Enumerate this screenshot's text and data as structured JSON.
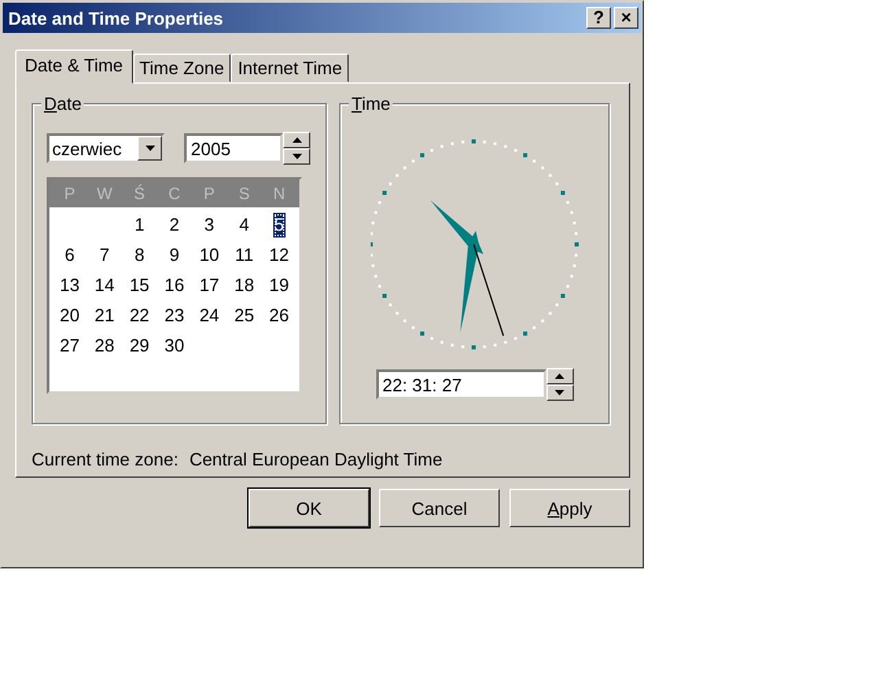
{
  "window": {
    "title": "Date and Time Properties",
    "title_buttons": [
      "?",
      "×"
    ]
  },
  "tabs": [
    {
      "label": "Date & Time",
      "selected": true
    },
    {
      "label": "Time Zone",
      "selected": false
    },
    {
      "label": "Internet Time",
      "selected": false
    }
  ],
  "date_group": {
    "label": "Date",
    "underlined_key": true,
    "month": "czerwiec",
    "year": "2005",
    "weekdays": [
      "P",
      "W",
      "Ś",
      "C",
      "P",
      "S",
      "N"
    ],
    "weeks": [
      [
        {
          "day": "1",
          "selected": false
        },
        {
          "day": "2",
          "selected": false
        },
        {
          "day": "3",
          "selected": false
        },
        {
          "day": "4",
          "selected": false
        },
        {
          "day": "5",
          "selected": true
        }
      ],
      [
        {
          "day": "6",
          "selected": false
        },
        {
          "day": "7",
          "selected": false
        },
        {
          "day": "8",
          "selected": false
        },
        {
          "day": "9",
          "selected": false
        },
        {
          "day": "10",
          "selected": false
        },
        {
          "day": "11",
          "selected": false
        },
        {
          "day": "12",
          "selected": false
        }
      ],
      [
        {
          "day": "13",
          "selected": false
        },
        {
          "day": "14",
          "selected": false
        },
        {
          "day": "15",
          "selected": false
        },
        {
          "day": "16",
          "selected": false
        },
        {
          "day": "17",
          "selected": false
        },
        {
          "day": "18",
          "selected": false
        },
        {
          "day": "19",
          "selected": false
        }
      ],
      [
        {
          "day": "20",
          "selected": false
        },
        {
          "day": "21",
          "selected": false
        },
        {
          "day": "22",
          "selected": false
        },
        {
          "day": "23",
          "selected": false
        },
        {
          "day": "24",
          "selected": false
        },
        {
          "day": "25",
          "selected": false
        },
        {
          "day": "26",
          "selected": false
        }
      ],
      [
        {
          "day": "27",
          "selected": false
        },
        {
          "day": "28",
          "selected": false
        },
        {
          "day": "29",
          "selected": false
        },
        {
          "day": "30",
          "selected": false
        }
      ]
    ]
  },
  "time_group": {
    "label": "Time",
    "underlined_key": true,
    "time": "22: 31: 27"
  },
  "time_zone": {
    "label": "Current time zone:",
    "value": "Central European Daylight Time"
  },
  "buttons": [
    {
      "label": "OK",
      "default": true,
      "underlined_key": false
    },
    {
      "label": "Cancel",
      "default": false,
      "underlined_key": false
    },
    {
      "label": "Apply",
      "default": false,
      "underlined_key": true
    }
  ]
}
